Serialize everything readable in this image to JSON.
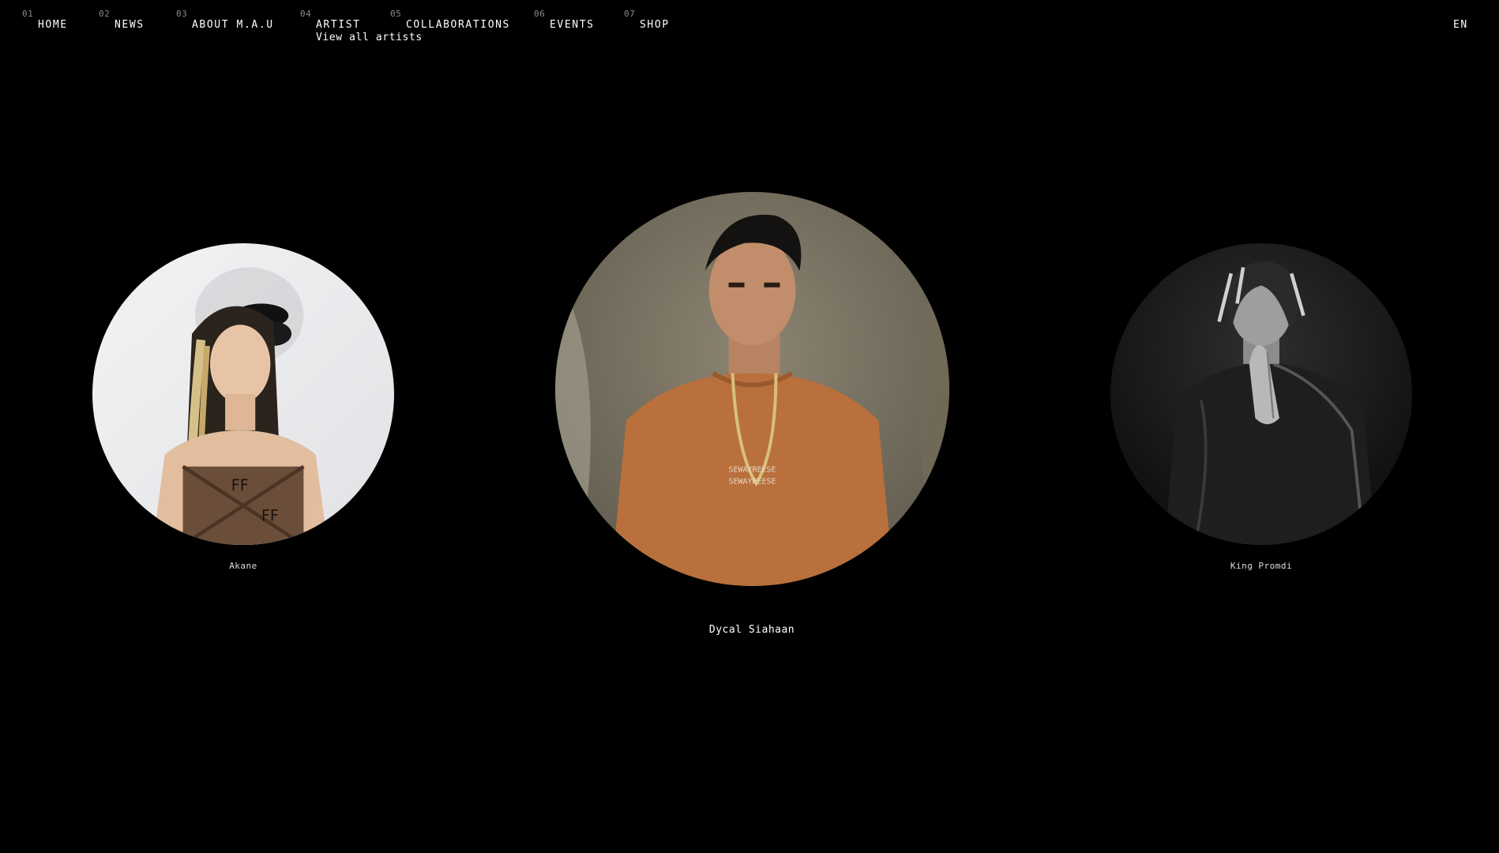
{
  "nav": {
    "items": [
      {
        "num": "01",
        "label": "HOME"
      },
      {
        "num": "02",
        "label": "NEWS"
      },
      {
        "num": "03",
        "label": "ABOUT M.A.U"
      },
      {
        "num": "04",
        "label": "ARTIST",
        "sub": "View all artists"
      },
      {
        "num": "05",
        "label": "COLLABORATIONS"
      },
      {
        "num": "06",
        "label": "EVENTS"
      },
      {
        "num": "07",
        "label": "SHOP"
      }
    ],
    "lang": "EN"
  },
  "artists": [
    {
      "name": "Akane"
    },
    {
      "name": "Dycal Siahaan"
    },
    {
      "name": "King Promdi"
    }
  ],
  "colors": {
    "background": "#000000",
    "text": "#ffffff",
    "muted": "#8a8a8a"
  }
}
